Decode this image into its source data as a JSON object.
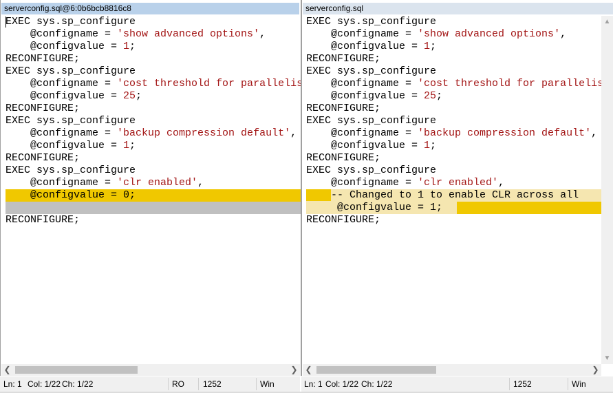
{
  "left": {
    "title": "serverconfig.sql@6:0b6bcb8816c8",
    "lines": [
      [
        [
          "EXEC sys.sp_configure",
          "kw"
        ]
      ],
      [
        [
          "    @configname = ",
          "kw"
        ],
        [
          "'show advanced options'",
          "str"
        ],
        [
          ",",
          "kw"
        ]
      ],
      [
        [
          "    @configvalue = ",
          "kw"
        ],
        [
          "1",
          "num"
        ],
        [
          ";",
          "kw"
        ]
      ],
      [
        [
          "RECONFIGURE;",
          "kw"
        ]
      ],
      [
        [
          "EXEC sys.sp_configure",
          "kw"
        ]
      ],
      [
        [
          "    @configname = ",
          "kw"
        ],
        [
          "'cost threshold for parallelism'",
          "str"
        ],
        [
          ",",
          "kw"
        ]
      ],
      [
        [
          "    @configvalue = ",
          "kw"
        ],
        [
          "25",
          "num"
        ],
        [
          ";",
          "kw"
        ]
      ],
      [
        [
          "RECONFIGURE;",
          "kw"
        ]
      ],
      [
        [
          "EXEC sys.sp_configure",
          "kw"
        ]
      ],
      [
        [
          "    @configname = ",
          "kw"
        ],
        [
          "'backup compression default'",
          "str"
        ],
        [
          ",",
          "kw"
        ]
      ],
      [
        [
          "    @configvalue = ",
          "kw"
        ],
        [
          "1",
          "num"
        ],
        [
          ";",
          "kw"
        ]
      ],
      [
        [
          "RECONFIGURE;",
          "kw"
        ]
      ],
      [
        [
          "EXEC sys.sp_configure",
          "kw"
        ]
      ],
      [
        [
          "    @configname = ",
          "kw"
        ],
        [
          "'clr enabled'",
          "str"
        ],
        [
          ",",
          "kw"
        ]
      ],
      [
        [
          "    @configvalue = 0;",
          "kw"
        ]
      ],
      [],
      [
        [
          "RECONFIGURE;",
          "kw"
        ]
      ]
    ],
    "status": {
      "ln": "Ln: 1",
      "col": "Col: 1/22",
      "ch": "Ch: 1/22",
      "mode": "RO",
      "codepage": "1252",
      "eol": "Win"
    }
  },
  "right": {
    "title": "serverconfig.sql",
    "lines": [
      [
        [
          "EXEC sys.sp_configure",
          "kw"
        ]
      ],
      [
        [
          "    @configname = ",
          "kw"
        ],
        [
          "'show advanced options'",
          "str"
        ],
        [
          ",",
          "kw"
        ]
      ],
      [
        [
          "    @configvalue = ",
          "kw"
        ],
        [
          "1",
          "num"
        ],
        [
          ";",
          "kw"
        ]
      ],
      [
        [
          "RECONFIGURE;",
          "kw"
        ]
      ],
      [
        [
          "EXEC sys.sp_configure",
          "kw"
        ]
      ],
      [
        [
          "    @configname = ",
          "kw"
        ],
        [
          "'cost threshold for parallelism'",
          "str"
        ],
        [
          ",",
          "kw"
        ]
      ],
      [
        [
          "    @configvalue = ",
          "kw"
        ],
        [
          "25",
          "num"
        ],
        [
          ";",
          "kw"
        ]
      ],
      [
        [
          "RECONFIGURE;",
          "kw"
        ]
      ],
      [
        [
          "EXEC sys.sp_configure",
          "kw"
        ]
      ],
      [
        [
          "    @configname = ",
          "kw"
        ],
        [
          "'backup compression default'",
          "str"
        ],
        [
          ",",
          "kw"
        ]
      ],
      [
        [
          "    @configvalue = ",
          "kw"
        ],
        [
          "1",
          "num"
        ],
        [
          ";",
          "kw"
        ]
      ],
      [
        [
          "RECONFIGURE;",
          "kw"
        ]
      ],
      [
        [
          "EXEC sys.sp_configure",
          "kw"
        ]
      ],
      [
        [
          "    @configname = ",
          "kw"
        ],
        [
          "'clr enabled'",
          "str"
        ],
        [
          ",",
          "kw"
        ]
      ],
      [
        [
          "    ",
          "kw"
        ],
        [
          "-- Changed to 1 to enable CLR across all",
          "kw"
        ]
      ],
      [
        [
          "     @configvalue = 1;",
          "kw"
        ]
      ],
      [
        [
          "RECONFIGURE;",
          "kw"
        ]
      ]
    ],
    "status": {
      "ln": "Ln: 1",
      "col": "Col: 1/22",
      "ch": "Ch: 1/22",
      "codepage": "1252",
      "eol": "Win"
    }
  },
  "colors": {
    "changed": "#f0c800",
    "changed_light": "#f5e6b0",
    "filler": "#c0c0c0",
    "string": "#a31515"
  }
}
